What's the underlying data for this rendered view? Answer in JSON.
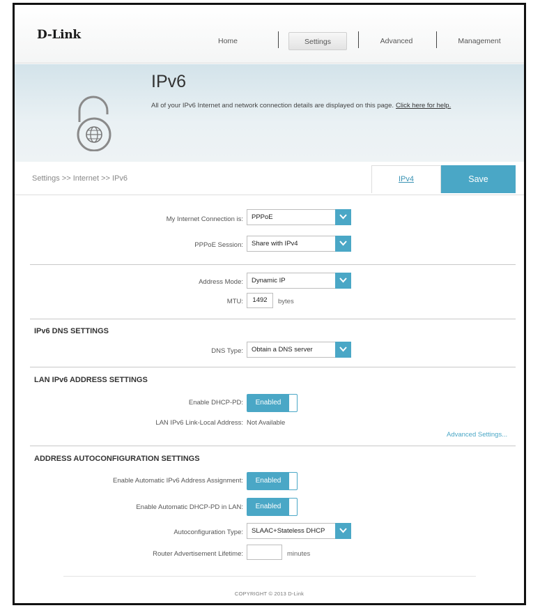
{
  "brand": {
    "logo": "D-Link",
    "accent_color": "#4aa7c6"
  },
  "nav": {
    "items": [
      {
        "label": "Home"
      },
      {
        "label": "Settings",
        "active": true
      },
      {
        "label": "Advanced"
      },
      {
        "label": "Management"
      }
    ]
  },
  "banner": {
    "title": "IPv6",
    "description": "All of your IPv6 Internet and network connection details are displayed on this page.",
    "help_link": "Click here for help.",
    "icon": "lock-globe-icon"
  },
  "breadcrumb": "Settings >> Internet >> IPv6",
  "tabs": {
    "ipv4": "IPv4",
    "save": "Save"
  },
  "connection": {
    "type_label": "My Internet Connection is:",
    "type_value": "PPPoE",
    "session_label": "PPPoE Session:",
    "session_value": "Share with IPv4"
  },
  "address": {
    "mode_label": "Address Mode:",
    "mode_value": "Dynamic IP",
    "mtu_label": "MTU:",
    "mtu_value": "1492",
    "mtu_unit": "bytes"
  },
  "dns": {
    "section_title": "IPv6 DNS SETTINGS",
    "type_label": "DNS Type:",
    "type_value": "Obtain a DNS server"
  },
  "lan": {
    "section_title": "LAN IPv6 ADDRESS SETTINGS",
    "dhcp_pd_label": "Enable DHCP-PD:",
    "dhcp_pd_value": "Enabled",
    "link_local_label": "LAN IPv6 Link-Local Address:",
    "link_local_value": "Not Available",
    "advanced_link": "Advanced Settings..."
  },
  "autoconfig": {
    "section_title": "ADDRESS AUTOCONFIGURATION SETTINGS",
    "auto_assign_label": "Enable Automatic IPv6 Address Assignment:",
    "auto_assign_value": "Enabled",
    "auto_dhcp_pd_label": "Enable Automatic DHCP-PD in LAN:",
    "auto_dhcp_pd_value": "Enabled",
    "type_label": "Autoconfiguration Type:",
    "type_value": "SLAAC+Stateless DHCP",
    "lifetime_label": "Router Advertisement Lifetime:",
    "lifetime_value": "",
    "lifetime_unit": "minutes"
  },
  "footer": {
    "copyright": "COPYRIGHT © 2013 D-Link"
  }
}
